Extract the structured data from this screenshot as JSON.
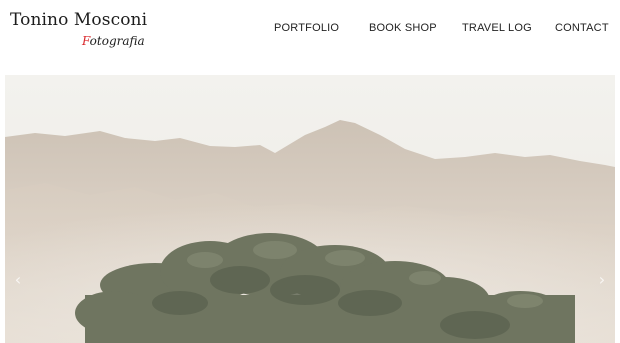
{
  "brand": {
    "name": "Tonino Mosconi",
    "subtitle_first_letter": "F",
    "subtitle_rest": "otografia",
    "accent_color": "#d9262a"
  },
  "nav": {
    "items": [
      {
        "label": "PORTFOLIO"
      },
      {
        "label": "BOOK SHOP"
      },
      {
        "label": "TRAVEL LOG"
      },
      {
        "label": "CONTACT"
      }
    ]
  },
  "hero": {
    "image_subject": "hazy-mountains-with-tree",
    "prev_icon": "chevron-left-icon",
    "prev_glyph": "‹",
    "next_icon": "chevron-right-icon",
    "next_glyph": "›"
  }
}
